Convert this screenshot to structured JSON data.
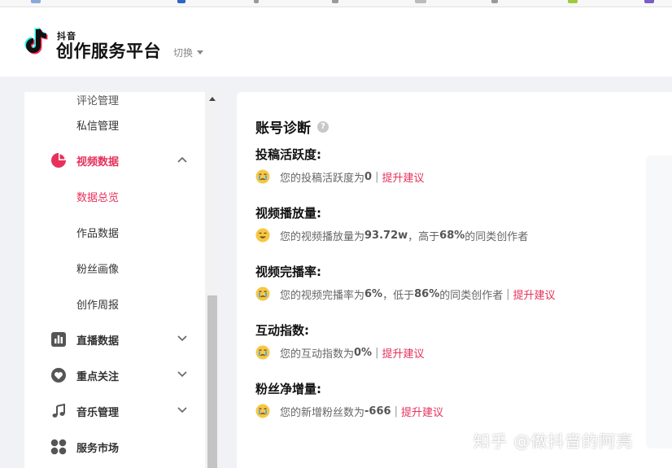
{
  "header": {
    "logo_small": "抖音",
    "logo_title": "创作服务平台",
    "switch_label": "切换"
  },
  "sidebar": {
    "cut_item": "评论管理",
    "items": [
      {
        "label": "私信管理",
        "kind": "sub"
      },
      {
        "label": "视频数据",
        "kind": "parent",
        "icon": "pie-chart-icon",
        "expanded": true
      },
      {
        "label": "数据总览",
        "kind": "sub",
        "active": true
      },
      {
        "label": "作品数据",
        "kind": "sub"
      },
      {
        "label": "粉丝画像",
        "kind": "sub"
      },
      {
        "label": "创作周报",
        "kind": "sub"
      },
      {
        "label": "直播数据",
        "kind": "parent",
        "icon": "bar-chart-icon",
        "expanded": false
      },
      {
        "label": "重点关注",
        "kind": "parent",
        "icon": "heart-icon",
        "expanded": false
      },
      {
        "label": "音乐管理",
        "kind": "parent",
        "icon": "music-note-icon",
        "expanded": false
      },
      {
        "label": "服务市场",
        "kind": "parent",
        "icon": "grid-icon",
        "expanded": false
      }
    ]
  },
  "main": {
    "title": "账号诊断",
    "help_glyph": "?",
    "metrics": [
      {
        "title": "投稿活跃度:",
        "emoji": "crying-face-icon",
        "prefix": "您的投稿活跃度为",
        "value": "0",
        "mid": "",
        "value2": "",
        "suffix": "",
        "separator": "|",
        "suggest": "提升建议"
      },
      {
        "title": "视频播放量:",
        "emoji": "smiling-face-icon",
        "prefix": "您的视频播放量为",
        "value": "93.72w",
        "mid": "，高于",
        "value2": "68%",
        "suffix": "的同类创作者",
        "separator": "",
        "suggest": ""
      },
      {
        "title": "视频完播率:",
        "emoji": "crying-face-icon",
        "prefix": "您的视频完播率为",
        "value": "6%",
        "mid": "，低于",
        "value2": "86%",
        "suffix": "的同类创作者",
        "separator": "|",
        "suggest": "提升建议"
      },
      {
        "title": "互动指数:",
        "emoji": "crying-face-icon",
        "prefix": "您的互动指数为",
        "value": "0%",
        "mid": "",
        "value2": "",
        "suffix": "",
        "separator": "|",
        "suggest": "提升建议"
      },
      {
        "title": "粉丝净增量:",
        "emoji": "crying-face-icon",
        "prefix": "您的新增粉丝数为",
        "value": "-666",
        "mid": "",
        "value2": "",
        "suffix": "",
        "separator": "|",
        "suggest": "提升建议"
      }
    ]
  },
  "watermark": "知乎 @做抖音的阿亮",
  "colors": {
    "accent": "#e6325b",
    "background": "#f1f2f5",
    "panel": "#ffffff",
    "emoji_face": "#f6c744"
  }
}
